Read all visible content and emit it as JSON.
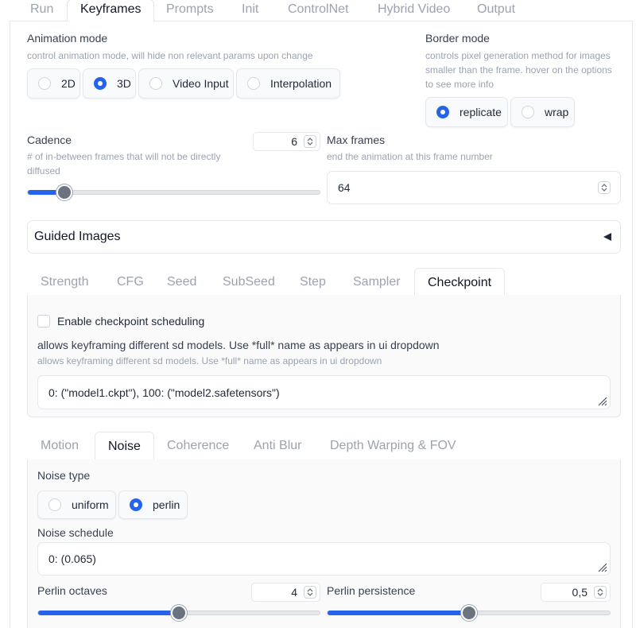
{
  "top_tabs": [
    "Run",
    "Keyframes",
    "Prompts",
    "Init",
    "ControlNet",
    "Hybrid Video",
    "Output"
  ],
  "animation_mode": {
    "label": "Animation mode",
    "info": "control animation mode, will hide non relevant params upon change",
    "options": [
      "2D",
      "3D",
      "Video Input",
      "Interpolation"
    ],
    "selected": "3D"
  },
  "border_mode": {
    "label": "Border mode",
    "info_lines": [
      "controls pixel generation method for images",
      "smaller than the frame. hover on the options",
      "to see more info"
    ],
    "options": [
      "replicate",
      "wrap"
    ],
    "selected": "replicate"
  },
  "cadence": {
    "label": "Cadence",
    "info_lines": [
      "# of in-between frames that will not be directly",
      "diffused"
    ],
    "value": "6",
    "slider_fraction": 0.125
  },
  "max_frames": {
    "label": "Max frames",
    "info": "end the animation at this frame number",
    "value": "64"
  },
  "guided_images": {
    "label": "Guided Images",
    "toggle_icon": "triangle-left-icon"
  },
  "schedule_tabs": [
    "Strength",
    "CFG",
    "Seed",
    "SubSeed",
    "Step",
    "Sampler",
    "Checkpoint"
  ],
  "checkpoint": {
    "enable_label": "Enable checkpoint scheduling",
    "enabled": false,
    "heading": "allows keyframing different sd models. Use *full* name as appears in ui dropdown",
    "info": "allows keyframing different sd models. Use *full* name as appears in ui dropdown",
    "value": "0: (\"model1.ckpt\"), 100: (\"model2.safetensors\")"
  },
  "motion_tabs": [
    "Motion",
    "Noise",
    "Coherence",
    "Anti Blur",
    "Depth Warping & FOV"
  ],
  "noise": {
    "type_label": "Noise type",
    "type_options": [
      "uniform",
      "perlin"
    ],
    "type_selected": "perlin",
    "schedule_label": "Noise schedule",
    "schedule_value": "0: (0.065)",
    "octaves_label": "Perlin octaves",
    "octaves_value": "4",
    "octaves_fraction": 0.5,
    "persistence_label": "Perlin persistence",
    "persistence_value": "0,5",
    "persistence_fraction": 0.5
  },
  "colors": {
    "accent": "#2563eb",
    "border": "#e5e7eb",
    "muted_text": "#9ca3af"
  }
}
